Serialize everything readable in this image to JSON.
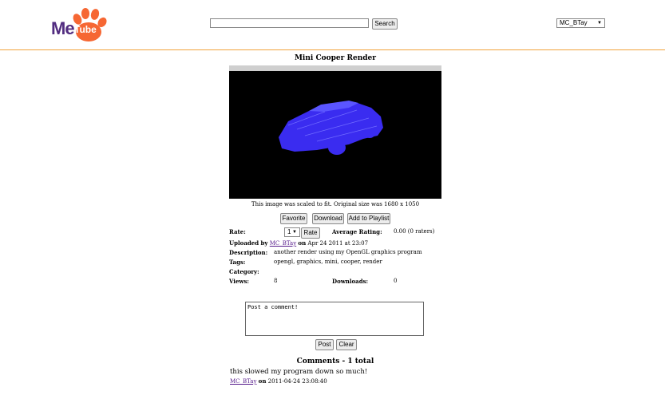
{
  "logo": {
    "me": "Me",
    "tube": "Tube"
  },
  "search": {
    "value": "",
    "button": "Search"
  },
  "user_menu": {
    "selected": "MC_BTay"
  },
  "video": {
    "title": "Mini Cooper Render",
    "caption": "This image was scaled to fit. Original size was 1680 x 1050"
  },
  "actions": {
    "favorite": "Favorite",
    "download": "Download",
    "playlist": "Add to Playlist"
  },
  "rating": {
    "rate_label": "Rate:",
    "selected": "1",
    "rate_button": "Rate",
    "avg_label": "Average Rating:",
    "avg_value": "0.00 (0 raters)"
  },
  "upload": {
    "prefix": "Uploaded by",
    "user": "MC_BTay",
    "on": "on",
    "date": "Apr 24 2011 at 23:07"
  },
  "details": {
    "description_label": "Description:",
    "description": "another render using my OpenGL graphics program",
    "tags_label": "Tags:",
    "tags": "opengl, graphics, mini, cooper, render",
    "category_label": "Category:",
    "views_label": "Views:",
    "views": "8",
    "downloads_label": "Downloads:",
    "downloads": "0"
  },
  "comment_form": {
    "placeholder": "Post a comment!",
    "post": "Post",
    "clear": "Clear"
  },
  "comments": {
    "heading": "Comments - 1 total",
    "items": [
      {
        "text": "this slowed my program down so much!",
        "user": "MC_BTay",
        "on": "on",
        "date": "2011-04-24 23:08:40"
      }
    ]
  },
  "colors": {
    "accent": "#f2a33a",
    "brand_purple": "#522d80",
    "paw": "#f66733",
    "car": "#3a2cf0"
  }
}
